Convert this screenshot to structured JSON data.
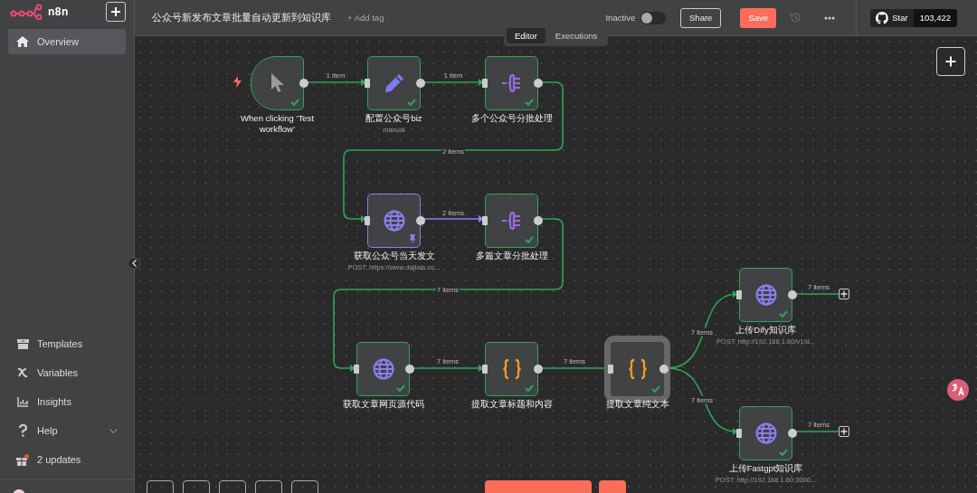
{
  "sidebar": {
    "brand": "n8n",
    "items": [
      {
        "label": "Overview",
        "selected": true
      }
    ],
    "bottom_items": [
      {
        "kind": "templates",
        "label": "Templates"
      },
      {
        "kind": "variables",
        "label": "Variables"
      },
      {
        "kind": "insights",
        "label": "Insights"
      },
      {
        "kind": "help",
        "label": "Help",
        "expandable": true
      },
      {
        "kind": "updates",
        "label": "2 updates",
        "badge": true
      }
    ]
  },
  "header": {
    "title": "公众号新发布文章批量自动更新到知识库",
    "add_tag": "+ Add tag",
    "tabs": [
      {
        "label": "Editor",
        "selected": true
      },
      {
        "label": "Executions",
        "selected": false
      }
    ],
    "active_label": "Inactive",
    "active": false,
    "share": "Share",
    "save": "Save",
    "github": {
      "label": "Star",
      "count": "103,422"
    }
  },
  "nodes": [
    {
      "kind": "trigger",
      "label": "When clicking ‘Test workflow’",
      "success": true,
      "pinned": false,
      "selected": false
    },
    {
      "kind": "set",
      "label": "配置公众号biz",
      "subtitle": "manual",
      "success": true,
      "pinned": false,
      "selected": false
    },
    {
      "kind": "split",
      "label": "多个公众号分批处理",
      "success": true,
      "pinned": false,
      "selected": false
    },
    {
      "kind": "http",
      "label": "获取公众号当天发文",
      "subtitle": "POST: https://www.dajiala.co...",
      "success": false,
      "pinned": true,
      "selected": false
    },
    {
      "kind": "split",
      "label": "多篇文章分批处理",
      "success": true,
      "pinned": false,
      "selected": false
    },
    {
      "kind": "http",
      "label": "获取文章网页源代码",
      "success": true,
      "pinned": false,
      "selected": false
    },
    {
      "kind": "code",
      "label": "提取文章标题和内容",
      "success": true,
      "pinned": false,
      "selected": false
    },
    {
      "kind": "code",
      "label": "提取文章纯文本",
      "success": true,
      "pinned": false,
      "selected": true
    },
    {
      "kind": "http",
      "label": "上传Dify知识库",
      "subtitle": "POST: http://192.168.1.60/v1/d...",
      "success": true,
      "pinned": false,
      "selected": false
    },
    {
      "kind": "http",
      "label": "上传Fastgpt知识库",
      "subtitle": "POST: http://192.168.1.60:3000...",
      "success": true,
      "pinned": false,
      "selected": false
    }
  ],
  "connections": [
    {
      "label": "1 item",
      "pinned": false
    },
    {
      "label": "1 item",
      "pinned": false
    },
    {
      "label": "2 items",
      "pinned": false
    },
    {
      "label": "2 items",
      "pinned": true
    },
    {
      "label": "7 items",
      "pinned": false
    },
    {
      "label": "7 items",
      "pinned": false
    },
    {
      "label": "7 items",
      "pinned": false
    },
    {
      "label": "7 items",
      "pinned": false
    },
    {
      "label": "7 items",
      "pinned": false
    },
    {
      "label": "7 items"
    },
    {
      "label": "7 items"
    }
  ]
}
